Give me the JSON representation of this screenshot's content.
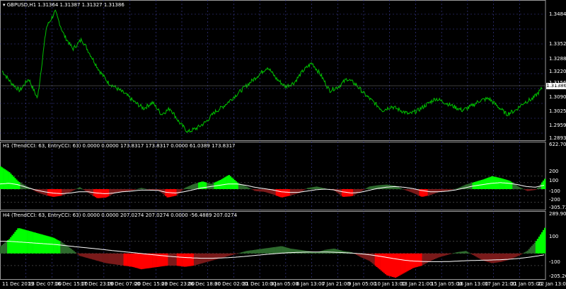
{
  "main": {
    "title_arrow": "▾",
    "title": "GBPUSD,H1  1.31364 1.31387 1.31327 1.31386",
    "price_axis": [
      "1.34845",
      "1.33525",
      "1.32880",
      "1.32205",
      "1.31560",
      "1.30900",
      "1.30255",
      "1.29595",
      "1.28935"
    ],
    "current_price": "1.31386",
    "line_color": "#00c000",
    "series": [
      1.322,
      1.316,
      1.312,
      1.318,
      1.308,
      1.344,
      1.352,
      1.34,
      1.333,
      1.338,
      1.33,
      1.322,
      1.316,
      1.313,
      1.31,
      1.306,
      1.303,
      1.306,
      1.3,
      1.303,
      1.296,
      1.291,
      1.293,
      1.296,
      1.301,
      1.304,
      1.308,
      1.312,
      1.316,
      1.32,
      1.324,
      1.318,
      1.314,
      1.316,
      1.322,
      1.326,
      1.32,
      1.312,
      1.314,
      1.318,
      1.315,
      1.31,
      1.306,
      1.302,
      1.304,
      1.302,
      1.3,
      1.302,
      1.305,
      1.308,
      1.306,
      1.304,
      1.302,
      1.304,
      1.307,
      1.308,
      1.304,
      1.3,
      1.302,
      1.306,
      1.308,
      1.313
    ]
  },
  "ind1": {
    "title": "H1 (TrendCCI: 63, EntryCCI: 63)  0.0000 0.0000 173.8317 173.8317 0.0000 61.0389 173.8317",
    "axis": [
      "622.7075",
      "200",
      "100",
      "-100",
      "-200",
      "-305.7399"
    ],
    "levels": [
      200,
      100,
      0,
      -100,
      -200
    ],
    "range": [
      -305.7399,
      622.7075
    ],
    "cci": [
      350,
      260,
      120,
      40,
      -40,
      -90,
      -120,
      -100,
      -40,
      30,
      -60,
      -140,
      -130,
      -60,
      -40,
      -20,
      20,
      -10,
      -20,
      -130,
      -100,
      20,
      80,
      120,
      80,
      140,
      220,
      100,
      40,
      -30,
      -40,
      -80,
      -130,
      -100,
      -60,
      20,
      40,
      10,
      -20,
      -120,
      -110,
      -40,
      40,
      60,
      70,
      50,
      -10,
      -60,
      -120,
      -90,
      -40,
      -20,
      10,
      70,
      110,
      150,
      200,
      170,
      130,
      40,
      -30,
      -10,
      160
    ],
    "signal": [
      80,
      90,
      70,
      30,
      -10,
      -40,
      -60,
      -70,
      -60,
      -40,
      -40,
      -60,
      -70,
      -60,
      -40,
      -30,
      -15,
      -15,
      -20,
      -50,
      -60,
      -40,
      -10,
      20,
      40,
      60,
      80,
      80,
      60,
      30,
      10,
      -10,
      -40,
      -50,
      -50,
      -30,
      -10,
      0,
      -10,
      -40,
      -60,
      -50,
      -20,
      10,
      30,
      40,
      30,
      10,
      -20,
      -40,
      -40,
      -30,
      -10,
      20,
      50,
      70,
      90,
      100,
      90,
      70,
      40,
      30,
      60
    ]
  },
  "ind2": {
    "title": "H4 (TrendCCI: 63, EntryCCI: 63)  0.0000 0.0000 207.0274 207.0274 0.0000 -56.4889 207.0274",
    "axis": [
      "289.9013",
      "100",
      "-100",
      "-205.2653"
    ],
    "levels": [
      100,
      0,
      -100
    ],
    "range": [
      -205.2653,
      289.9013
    ],
    "cci": [
      60,
      120,
      210,
      190,
      170,
      150,
      130,
      90,
      40,
      -20,
      -40,
      -60,
      -80,
      -90,
      -100,
      -110,
      -130,
      -120,
      -110,
      -100,
      -100,
      -110,
      -100,
      -80,
      -60,
      -40,
      -20,
      0,
      20,
      30,
      40,
      50,
      60,
      40,
      30,
      20,
      10,
      30,
      40,
      20,
      10,
      -30,
      -60,
      -120,
      -180,
      -200,
      -160,
      -120,
      -100,
      -60,
      -30,
      -10,
      10,
      20,
      -20,
      -60,
      -80,
      -70,
      -50,
      -20,
      20,
      100,
      210
    ],
    "signal": [
      100,
      100,
      95,
      90,
      85,
      80,
      75,
      68,
      60,
      52,
      45,
      38,
      30,
      22,
      15,
      8,
      0,
      -8,
      -15,
      -22,
      -28,
      -33,
      -37,
      -40,
      -40,
      -38,
      -35,
      -30,
      -24,
      -17,
      -10,
      -4,
      2,
      6,
      9,
      11,
      12,
      12,
      10,
      7,
      3,
      -2,
      -10,
      -20,
      -32,
      -44,
      -55,
      -62,
      -66,
      -68,
      -68,
      -67,
      -64,
      -60,
      -58,
      -56,
      -54,
      -52,
      -48,
      -42,
      -34,
      -24,
      -12
    ]
  },
  "time_axis": [
    "11 Dec 2019",
    "13 Dec 07:00",
    "16 Dec 15:00",
    "17 Dec 23:00",
    "19 Dec 07:00",
    "20 Dec 15:00",
    "23 Dec 23:00",
    "26 Dec 18:00",
    "30 Dec 02:00",
    "31 Dec 10:00",
    "3 Jan 05:00",
    "6 Jan 13:00",
    "7 Jan 21:00",
    "9 Jan 05:00",
    "10 Jan 13:00",
    "13 Jan 21:00",
    "15 Jan 05:00",
    "16 Jan 13:00",
    "17 Jan 21:00",
    "21 Jan 05:00",
    "22 Jan 13:00"
  ],
  "colors": {
    "bull_strong": "#00ff00",
    "bull_weak": "#2e6b2e",
    "bear_strong": "#ff0000",
    "bear_weak": "#7a1a1a",
    "signal": "#ffffff",
    "grid": "#4040a0",
    "frame": "#9a9a9a"
  }
}
